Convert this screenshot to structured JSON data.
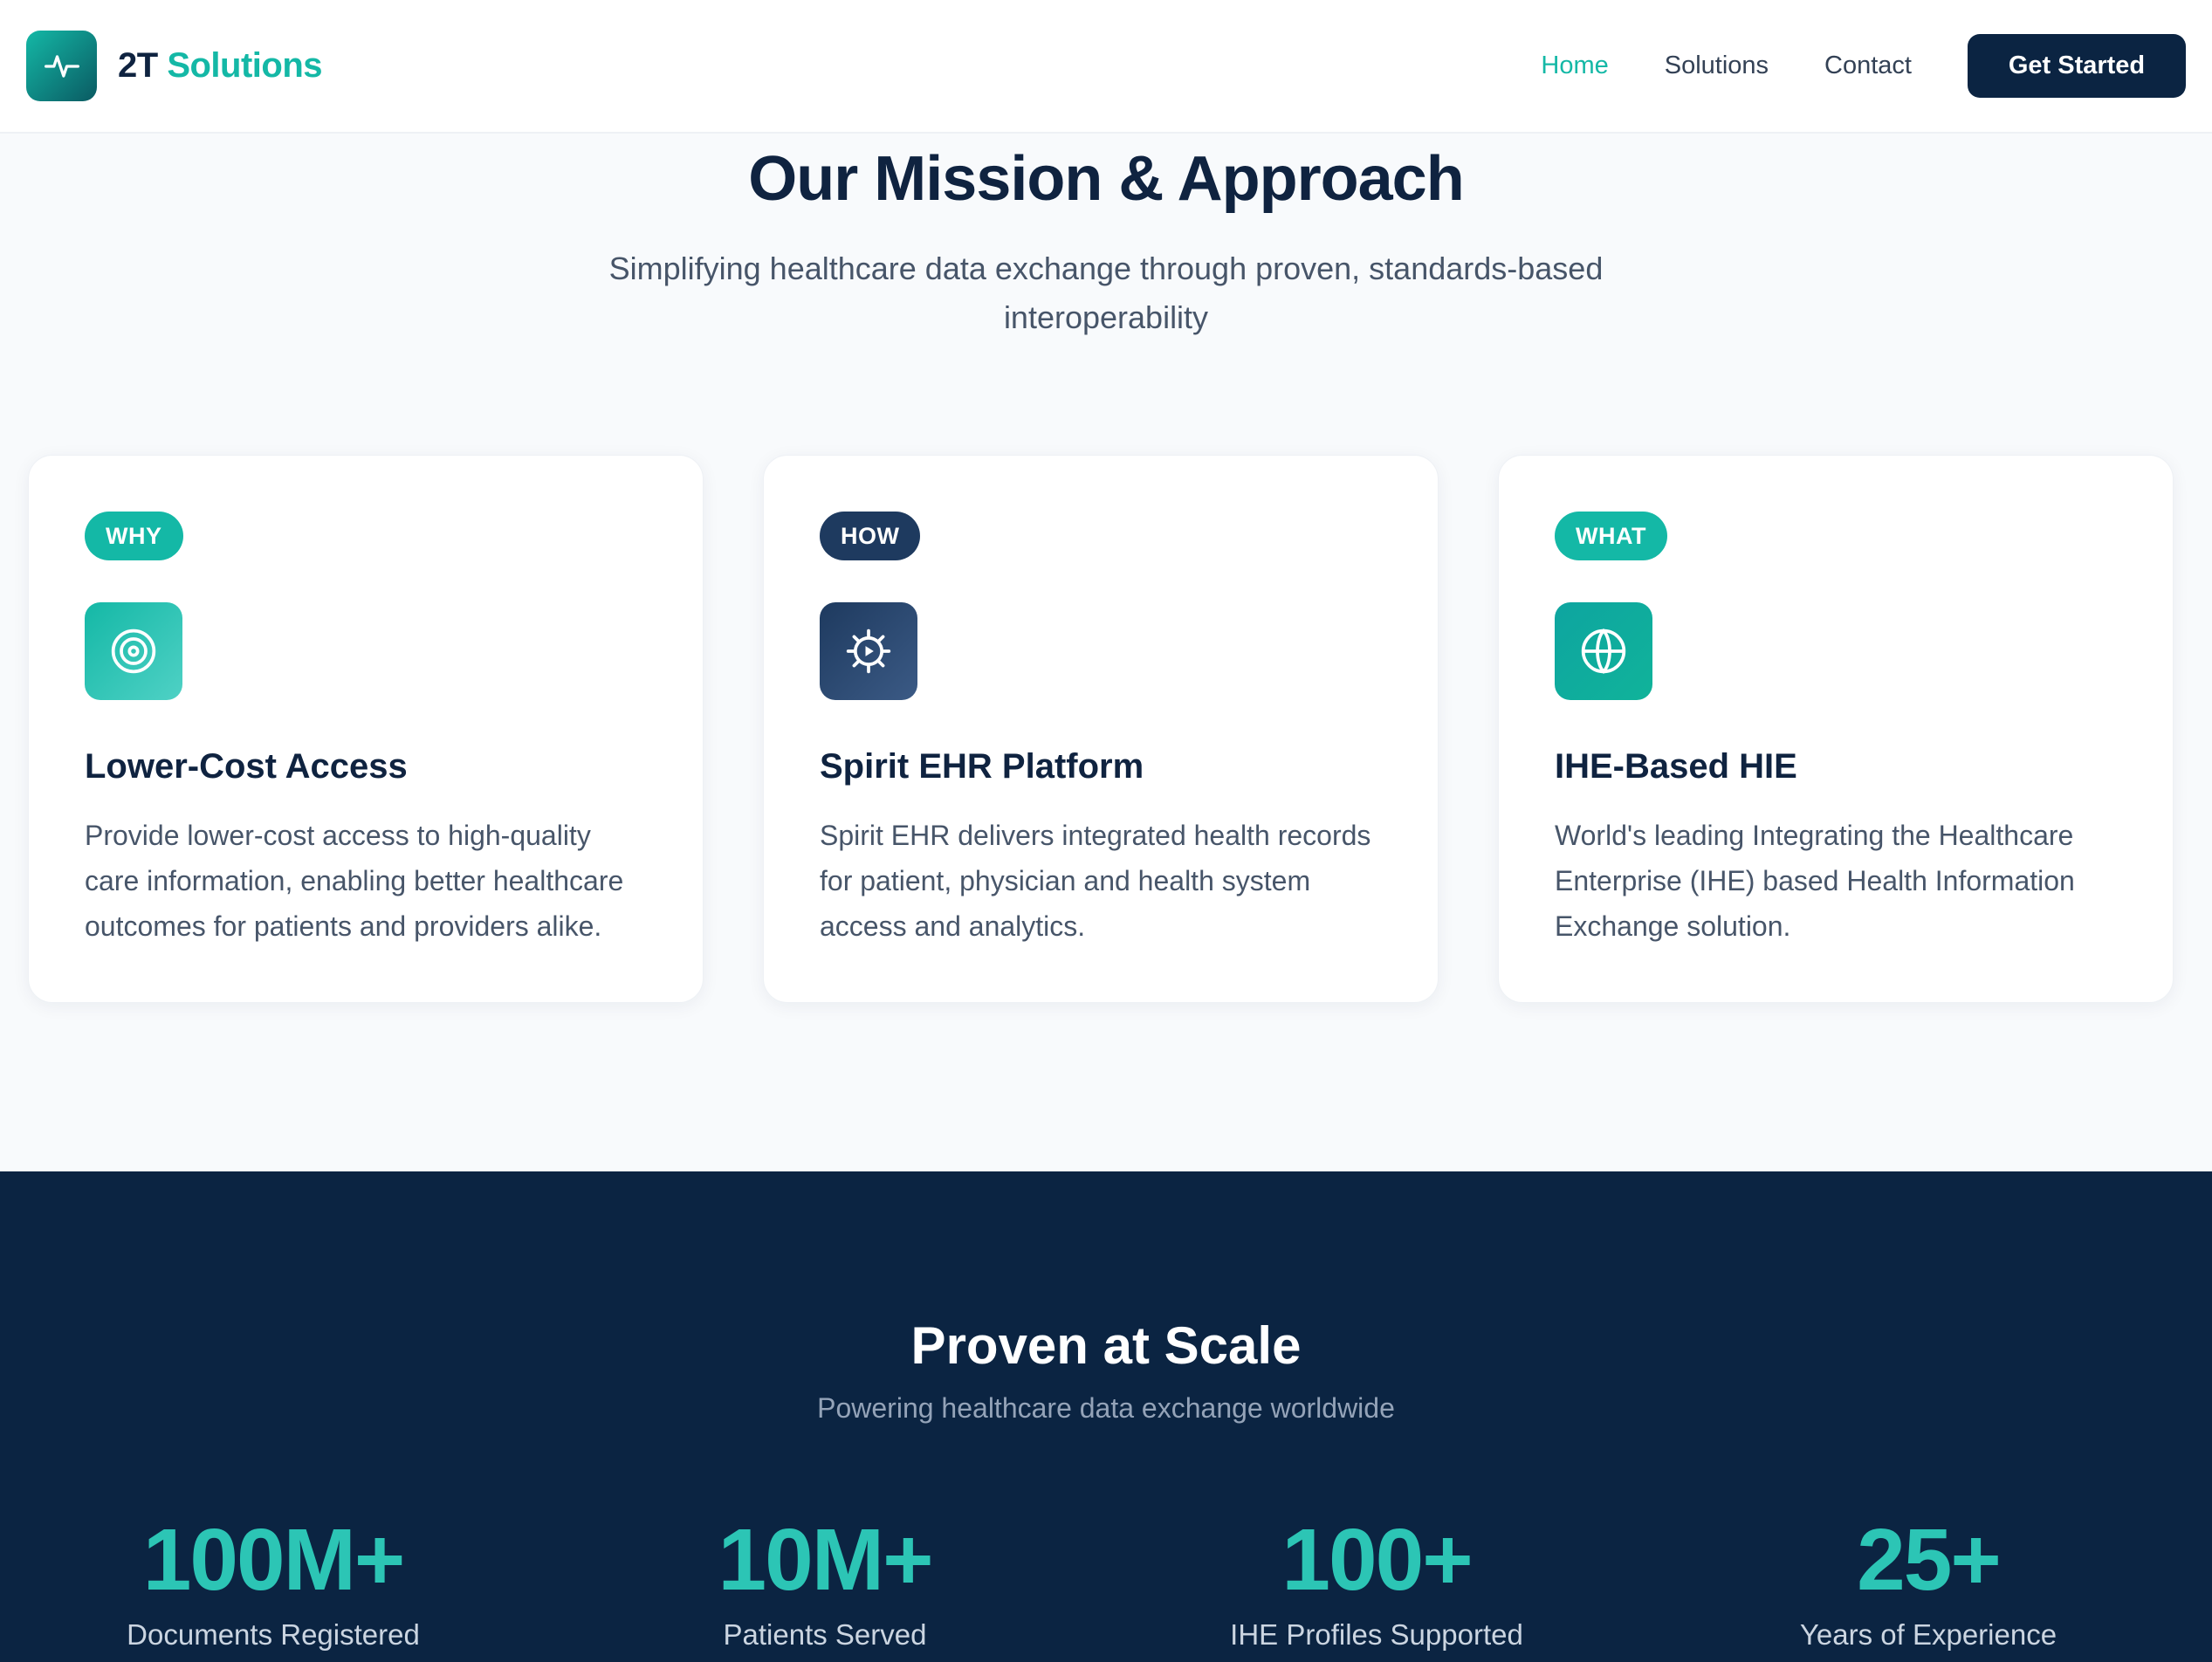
{
  "header": {
    "brand_prefix": "2T",
    "brand_suffix": "Solutions",
    "nav": [
      "Home",
      "Solutions",
      "Contact"
    ],
    "active_nav": "Home",
    "cta_label": "Get Started"
  },
  "mission": {
    "title": "Our Mission & Approach",
    "subtitle": "Simplifying healthcare data exchange through proven, standards-based interoperability",
    "cards": [
      {
        "tag": "WHY",
        "icon": "target-icon",
        "title": "Lower-Cost Access",
        "body": "Provide lower-cost access to high-quality care information, enabling better healthcare outcomes for patients and providers alike."
      },
      {
        "tag": "HOW",
        "icon": "gear-icon",
        "title": "Spirit EHR Platform",
        "body": "Spirit EHR delivers integrated health records for patient, physician and health system access and analytics."
      },
      {
        "tag": "WHAT",
        "icon": "globe-icon",
        "title": "IHE-Based HIE",
        "body": "World's leading Integrating the Healthcare Enterprise (IHE) based Health Information Exchange solution."
      }
    ]
  },
  "stats": {
    "title": "Proven at Scale",
    "subtitle": "Powering healthcare data exchange worldwide",
    "items": [
      {
        "value": "100M+",
        "label": "Documents Registered"
      },
      {
        "value": "10M+",
        "label": "Patients Served"
      },
      {
        "value": "100+",
        "label": "IHE Profiles Supported"
      },
      {
        "value": "25+",
        "label": "Years of Experience"
      }
    ]
  },
  "colors": {
    "accent": "#14b8a6",
    "navy": "#0b2442",
    "text": "#0f2340"
  }
}
